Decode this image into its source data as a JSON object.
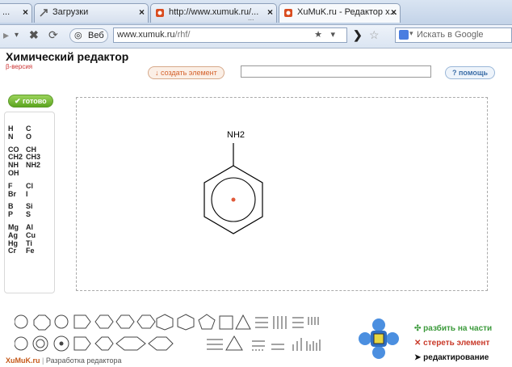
{
  "browser": {
    "tabs": [
      {
        "label": "...",
        "active": false
      },
      {
        "label": "Загрузки",
        "active": false
      },
      {
        "label": "http://www.xumuk.ru/...",
        "active": false
      },
      {
        "label": "XuMuK.ru - Редактор x...",
        "active": true
      }
    ],
    "tab_overflow": "...",
    "back_icon": "back-arrow-icon",
    "stop_icon": "stop-icon",
    "web_label": "Веб",
    "url_domain": "www.xumuk.ru",
    "url_path": "/rhf/",
    "search_placeholder": "Искать в Google"
  },
  "app": {
    "title": "Химический редактор",
    "beta": "β-версия",
    "create_button": "↓ создать элемент",
    "name_input_value": "",
    "help_button": "? помощь",
    "done_button": "✔ готово"
  },
  "palette": {
    "rows": [
      [
        "H",
        "C"
      ],
      [
        "N",
        "O"
      ],
      [
        "CO",
        "CH"
      ],
      [
        "CH2",
        "CH3"
      ],
      [
        "NH",
        "NH2"
      ],
      [
        "OH",
        ""
      ],
      [
        "F",
        "Cl"
      ],
      [
        "Br",
        "I"
      ],
      [
        "B",
        "Si"
      ],
      [
        "P",
        "S"
      ],
      [
        "Mg",
        "Al"
      ],
      [
        "Ag",
        "Cu"
      ],
      [
        "Hg",
        "Ti"
      ],
      [
        "Cr",
        "Fe"
      ]
    ]
  },
  "molecule": {
    "substituent": "NH2",
    "ring": "benzene"
  },
  "tools": {
    "split_button": "разбить на части",
    "erase_button": "стереть элемент",
    "edit_button": "редактирование"
  },
  "footer": {
    "logo": "XuMuK.ru",
    "link": "Разработка редактора"
  },
  "colors": {
    "accent_orange": "#d4612b",
    "done_green": "#5ca51f",
    "help_blue": "#3d6fa8"
  }
}
